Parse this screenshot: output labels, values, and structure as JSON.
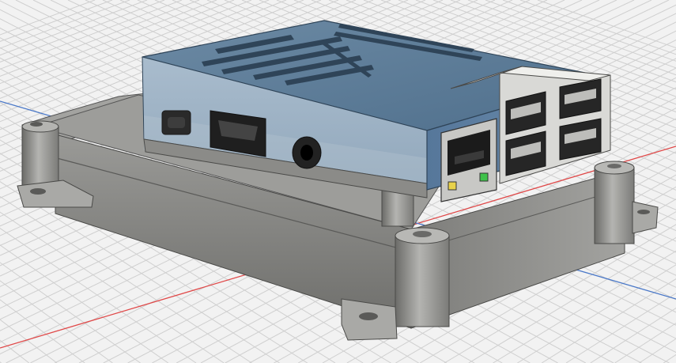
{
  "viewport": {
    "kind": "3d-cad-viewport",
    "background": "#f2f2f2",
    "grid_color": "#cfcfcf",
    "axis_x_color": "#e04848",
    "axis_z_color": "#4a78c8"
  },
  "model": {
    "base_color": "#8e8e8b",
    "case_color": "#6f8fa8",
    "case_highlight": "#9db3c6",
    "ports": [
      "micro-usb-port",
      "hdmi-port",
      "audio-jack",
      "ethernet-port",
      "usb-port-1",
      "usb-port-2",
      "usb-port-3",
      "usb-port-4"
    ],
    "led_colors": [
      "#e8d24a",
      "#3fc24a"
    ]
  }
}
